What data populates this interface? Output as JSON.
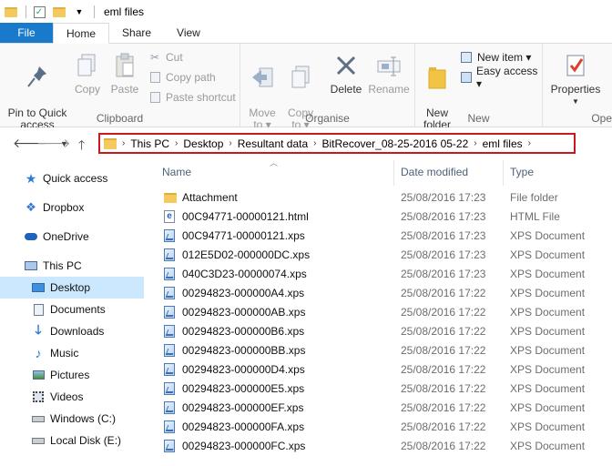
{
  "window": {
    "title": "eml files"
  },
  "tabs": [
    "File",
    "Home",
    "Share",
    "View"
  ],
  "ribbon": {
    "clipboard": {
      "label": "Clipboard",
      "pin": "Pin to Quick\naccess",
      "copy": "Copy",
      "paste": "Paste",
      "cut": "Cut",
      "copy_path": "Copy path",
      "paste_shortcut": "Paste shortcut"
    },
    "organise": {
      "label": "Organise",
      "move_to": "Move\nto ▾",
      "copy_to": "Copy\nto ▾",
      "delete": "Delete",
      "rename": "Rename"
    },
    "new": {
      "label": "New",
      "new_folder": "New\nfolder",
      "new_item": "New item ▾",
      "easy_access": "Easy access ▾"
    },
    "open": {
      "label": "Ope",
      "properties": "Properties"
    }
  },
  "address": {
    "crumbs": [
      "This PC",
      "Desktop",
      "Resultant data",
      "BitRecover_08-25-2016 05-22",
      "eml files"
    ]
  },
  "nav": [
    {
      "label": "Quick access",
      "icon": "star-icon"
    },
    {
      "label": "Dropbox",
      "icon": "dropbox-icon"
    },
    {
      "label": "OneDrive",
      "icon": "cloud-icon"
    },
    {
      "label": "This PC",
      "icon": "computer-icon"
    },
    {
      "label": "Desktop",
      "icon": "desktop-icon"
    },
    {
      "label": "Documents",
      "icon": "documents-icon"
    },
    {
      "label": "Downloads",
      "icon": "download-icon"
    },
    {
      "label": "Music",
      "icon": "music-icon"
    },
    {
      "label": "Pictures",
      "icon": "pictures-icon"
    },
    {
      "label": "Videos",
      "icon": "videos-icon"
    },
    {
      "label": "Windows (C:)",
      "icon": "drive-icon"
    },
    {
      "label": "Local Disk (E:)",
      "icon": "drive-icon"
    }
  ],
  "columns": {
    "name": "Name",
    "date": "Date modified",
    "type": "Type"
  },
  "files": [
    {
      "name": "Attachment",
      "date": "25/08/2016 17:23",
      "type": "File folder",
      "icon": "folder"
    },
    {
      "name": "00C94771-00000121.html",
      "date": "25/08/2016 17:23",
      "type": "HTML File",
      "icon": "html"
    },
    {
      "name": "00C94771-00000121.xps",
      "date": "25/08/2016 17:23",
      "type": "XPS Document",
      "icon": "xps"
    },
    {
      "name": "012E5D02-000000DC.xps",
      "date": "25/08/2016 17:23",
      "type": "XPS Document",
      "icon": "xps"
    },
    {
      "name": "040C3D23-00000074.xps",
      "date": "25/08/2016 17:23",
      "type": "XPS Document",
      "icon": "xps"
    },
    {
      "name": "00294823-000000A4.xps",
      "date": "25/08/2016 17:22",
      "type": "XPS Document",
      "icon": "xps"
    },
    {
      "name": "00294823-000000AB.xps",
      "date": "25/08/2016 17:22",
      "type": "XPS Document",
      "icon": "xps"
    },
    {
      "name": "00294823-000000B6.xps",
      "date": "25/08/2016 17:22",
      "type": "XPS Document",
      "icon": "xps"
    },
    {
      "name": "00294823-000000BB.xps",
      "date": "25/08/2016 17:22",
      "type": "XPS Document",
      "icon": "xps"
    },
    {
      "name": "00294823-000000D4.xps",
      "date": "25/08/2016 17:22",
      "type": "XPS Document",
      "icon": "xps"
    },
    {
      "name": "00294823-000000E5.xps",
      "date": "25/08/2016 17:22",
      "type": "XPS Document",
      "icon": "xps"
    },
    {
      "name": "00294823-000000EF.xps",
      "date": "25/08/2016 17:22",
      "type": "XPS Document",
      "icon": "xps"
    },
    {
      "name": "00294823-000000FA.xps",
      "date": "25/08/2016 17:22",
      "type": "XPS Document",
      "icon": "xps"
    },
    {
      "name": "00294823-000000FC.xps",
      "date": "25/08/2016 17:22",
      "type": "XPS Document",
      "icon": "xps"
    }
  ]
}
